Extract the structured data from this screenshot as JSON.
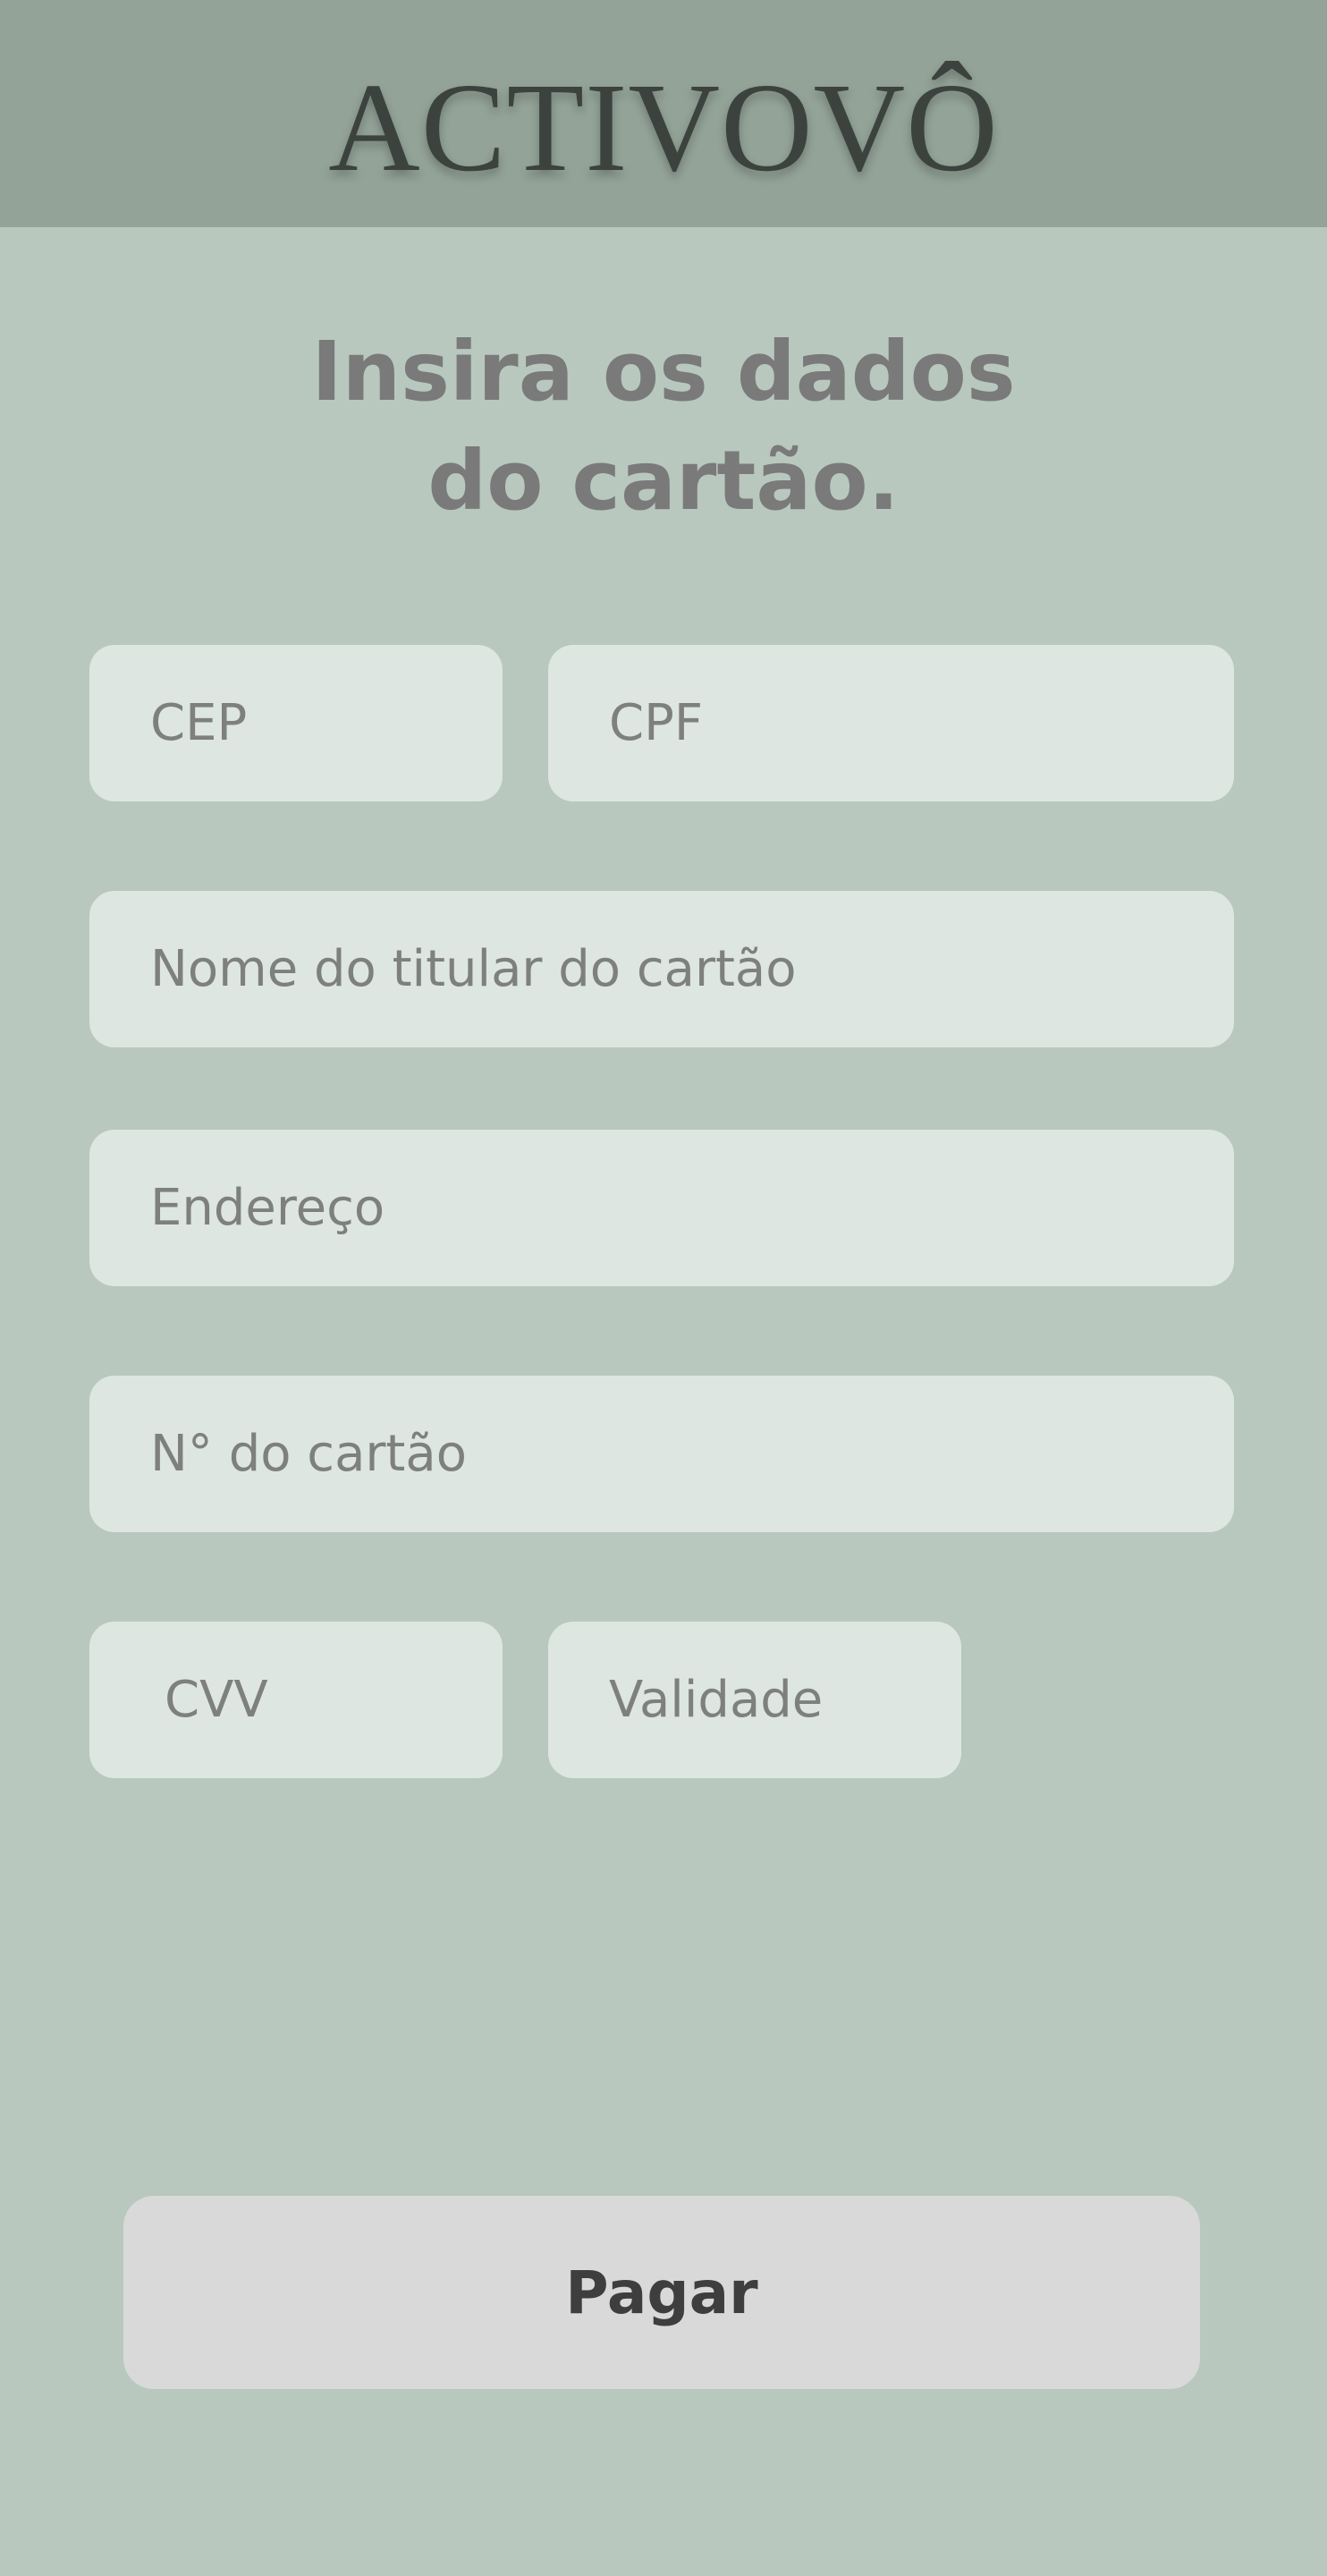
{
  "header": {
    "logo_text": "ACTIVOVÔ"
  },
  "main": {
    "heading_line1": "Insira os dados",
    "heading_line2": "do cartão."
  },
  "form": {
    "cep_placeholder": "CEP",
    "cpf_placeholder": "CPF",
    "cardholder_placeholder": "Nome do titular do cartão",
    "address_placeholder": "Endereço",
    "card_number_placeholder": "N° do cartão",
    "cvv_placeholder": "CVV",
    "expiry_placeholder": "Validade"
  },
  "actions": {
    "pay_label": "Pagar"
  },
  "colors": {
    "background": "#b8c8be",
    "header": "#93a398",
    "field": "#dee6e1",
    "button": "#d9d9d9"
  }
}
